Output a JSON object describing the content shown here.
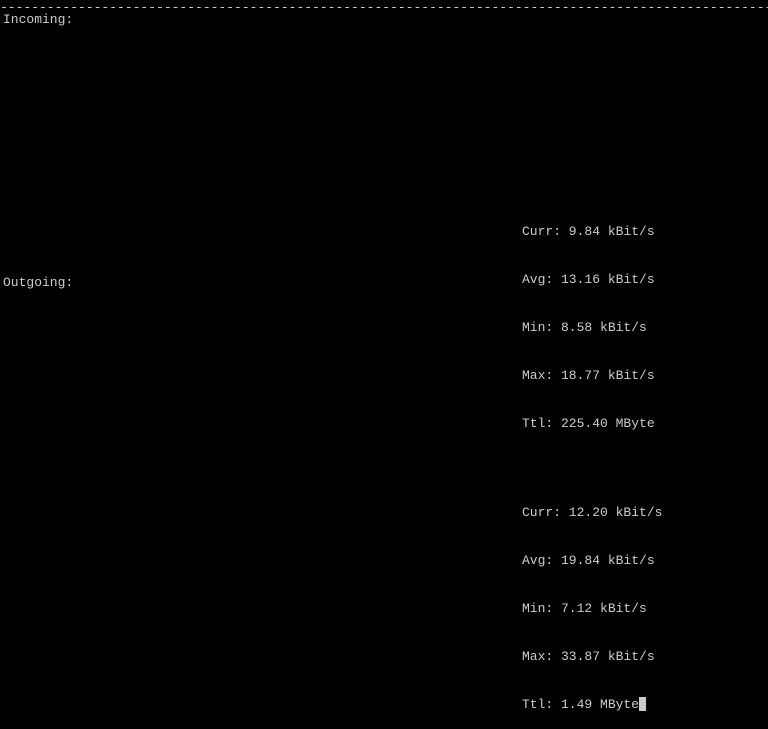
{
  "separator": "------------------------------------------------------------------------------------------------------------",
  "incoming": {
    "label": "Incoming:",
    "stats": {
      "curr": "Curr: 9.84 kBit/s",
      "avg": "Avg: 13.16 kBit/s",
      "min": "Min: 8.58 kBit/s",
      "max": "Max: 18.77 kBit/s",
      "ttl": "Ttl: 225.40 MByte"
    }
  },
  "outgoing": {
    "label": "Outgoing:",
    "stats": {
      "curr": "Curr: 12.20 kBit/s",
      "avg": "Avg: 19.84 kBit/s",
      "min": "Min: 7.12 kBit/s",
      "max": "Max: 33.87 kBit/s",
      "ttl": "Ttl: 1.49 MByte"
    }
  }
}
